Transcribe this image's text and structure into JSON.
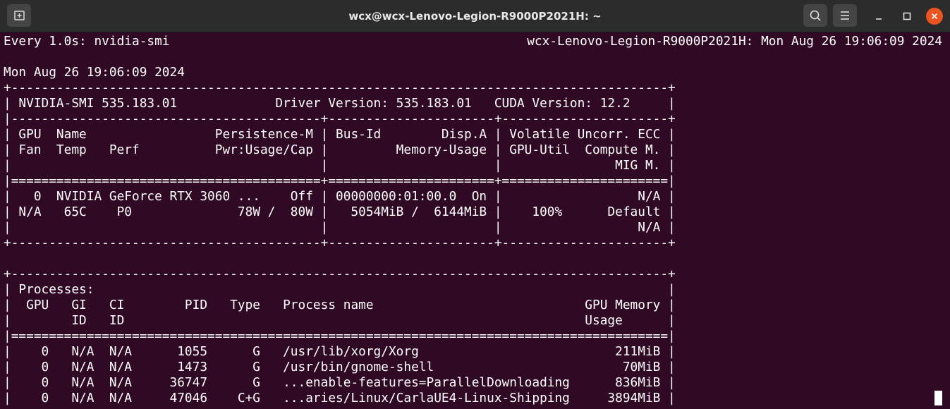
{
  "window": {
    "title": "wcx@wcx-Lenovo-Legion-R9000P2021H: ~",
    "buttons": {
      "new_tab_icon": "new-tab-icon",
      "search_icon": "search-icon",
      "menu_icon": "hamburger-menu-icon",
      "minimize_icon": "minimize-icon",
      "maximize_icon": "maximize-icon",
      "close_icon": "close-icon"
    },
    "colors": {
      "background": "#300a24",
      "titlebar": "#2c2c2c",
      "close": "#e95420",
      "text": "#ffffff"
    }
  },
  "terminal": {
    "watch_header_left": "Every 1.0s: nvidia-smi",
    "watch_header_right": "wcx-Lenovo-Legion-R9000P2021H: Mon Aug 26 19:06:09 2024",
    "lines": [
      "",
      "Mon Aug 26 19:06:09 2024",
      "+---------------------------------------------------------------------------------------+",
      "| NVIDIA-SMI 535.183.01             Driver Version: 535.183.01   CUDA Version: 12.2     |",
      "|-----------------------------------------+----------------------+----------------------+",
      "| GPU  Name                 Persistence-M | Bus-Id        Disp.A | Volatile Uncorr. ECC |",
      "| Fan  Temp   Perf          Pwr:Usage/Cap |         Memory-Usage | GPU-Util  Compute M. |",
      "|                                         |                      |               MIG M. |",
      "|=========================================+======================+======================|",
      "|   0  NVIDIA GeForce RTX 3060 ...    Off | 00000000:01:00.0  On |                  N/A |",
      "| N/A   65C    P0              78W /  80W |   5054MiB /  6144MiB |    100%      Default |",
      "|                                         |                      |                  N/A |",
      "+-----------------------------------------+----------------------+----------------------+",
      "",
      "+---------------------------------------------------------------------------------------+",
      "| Processes:                                                                            |",
      "|  GPU   GI   CI        PID   Type   Process name                            GPU Memory |",
      "|        ID   ID                                                             Usage      |",
      "|=======================================================================================|",
      "|    0   N/A  N/A      1055      G   /usr/lib/xorg/Xorg                          211MiB |",
      "|    0   N/A  N/A      1473      G   /usr/bin/gnome-shell                         70MiB |",
      "|    0   N/A  N/A     36747      G   ...enable-features=ParallelDownloading      836MiB |",
      "|    0   N/A  N/A     47046    C+G   ...aries/Linux/CarlaUE4-Linux-Shipping     3894MiB |"
    ]
  }
}
